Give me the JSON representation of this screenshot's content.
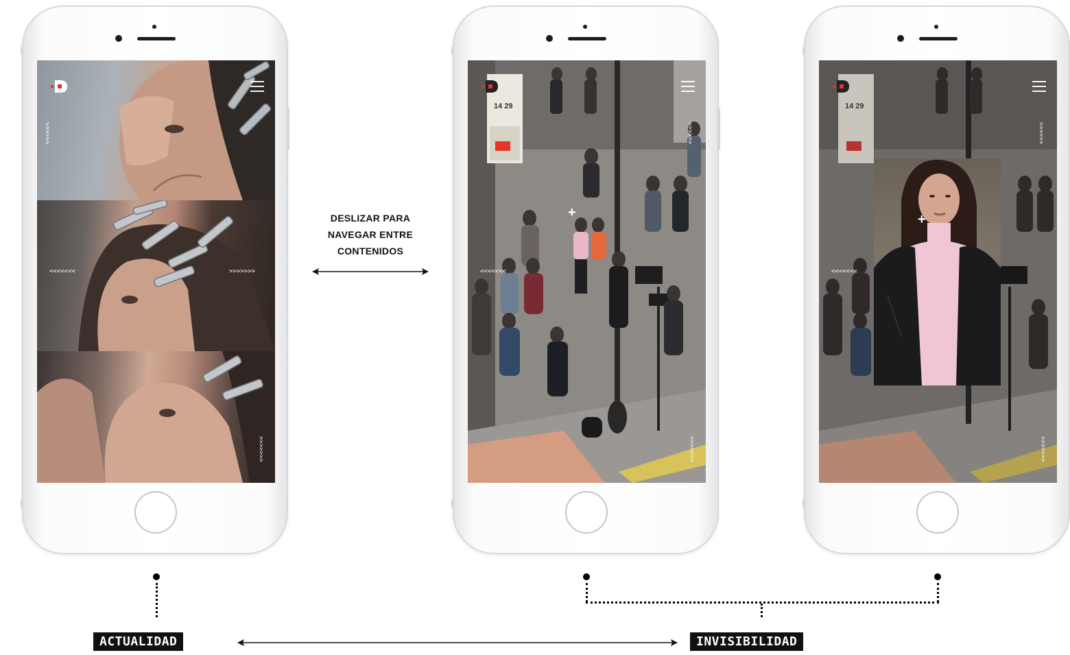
{
  "caption": {
    "line1": "DESLIZAR PARA",
    "line2": "NAVEGAR ENTRE",
    "line3": "CONTENIDOS"
  },
  "labels": {
    "left": "ACTUALIDAD",
    "right": "INVISIBILIDAD"
  },
  "phone1": {
    "chevron_up": "<<<<<<",
    "chevron_left": "<<<<<<<",
    "chevron_right": ">>>>>>>",
    "chevron_down": ">>>>>>>"
  },
  "phone2": {
    "chevron_up": "<<<<<<",
    "chevron_left": "<<<<<<<",
    "chevron_down": ">>>>>>>",
    "sign_calendar": "14 29"
  },
  "phone3": {
    "chevron_up": "<<<<<<",
    "chevron_left": "<<<<<<<",
    "chevron_down": ">>>>>>>",
    "sign_calendar": "14 29"
  },
  "colors": {
    "brand_red": "#e5352b",
    "label_bg": "#111111",
    "pink_sweater": "#f0c6d6"
  }
}
